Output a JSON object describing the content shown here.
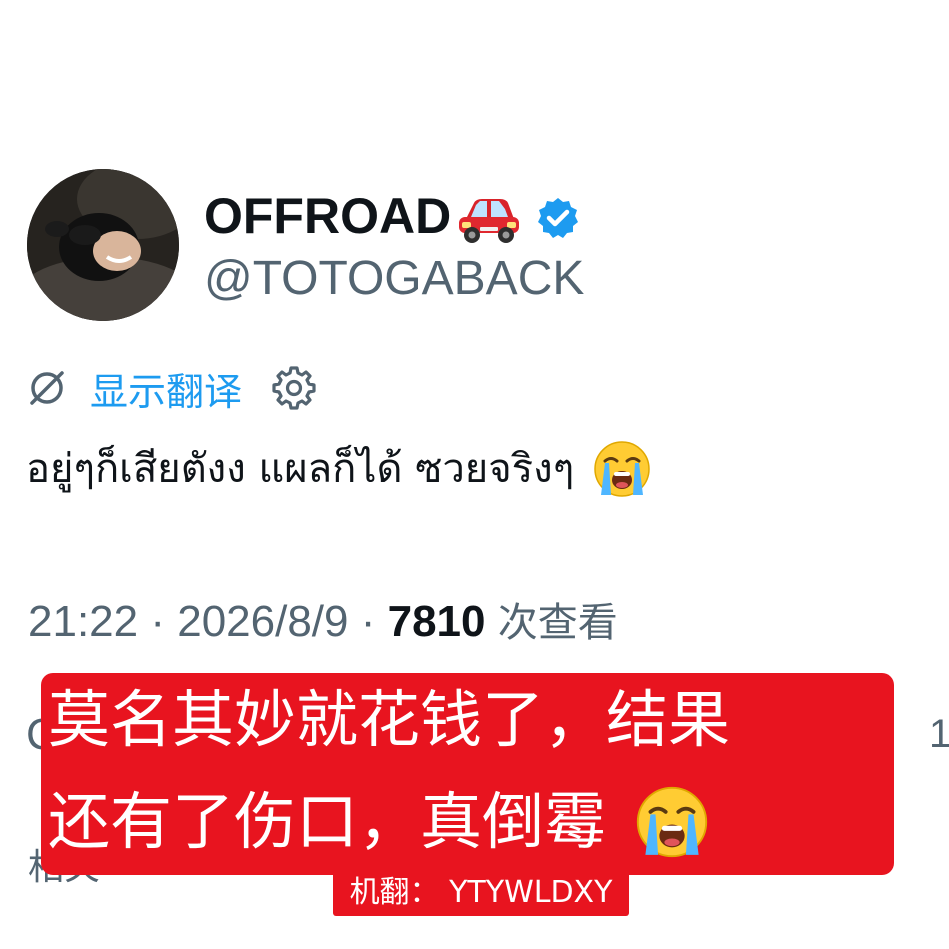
{
  "profile": {
    "display_name": "OFFROAD",
    "name_emoji_icon": "car-emoji-icon",
    "verified_icon": "verified-badge-icon",
    "handle": "@TOTOGABACK"
  },
  "translate": {
    "link_label": "显示翻译",
    "icon": "translate-icon",
    "settings_icon": "gear-icon"
  },
  "tweet": {
    "text": "อยู่ๆก็เสียตังง แผลก็ได้ ซวยจริงๆ",
    "emoji_icon": "loudly-crying-face-icon"
  },
  "meta": {
    "time": "21:22",
    "separator": " · ",
    "date": "2026/8/9",
    "views_count": "7810",
    "views_label": "次查看"
  },
  "peek": {
    "left_char": "C",
    "right_char": "1",
    "bottom_text": "相关"
  },
  "subtitle": {
    "line1": "莫名其妙就花钱了，结果",
    "line2": "还有了伤口，真倒霉",
    "emoji_icon": "loudly-crying-face-icon",
    "credit": "机翻：  YTYWLDXY"
  },
  "colors": {
    "accent_blue": "#1d9bf0",
    "secondary_text": "#536471",
    "primary_text": "#0f1419",
    "subtitle_bg": "#e8141f"
  }
}
